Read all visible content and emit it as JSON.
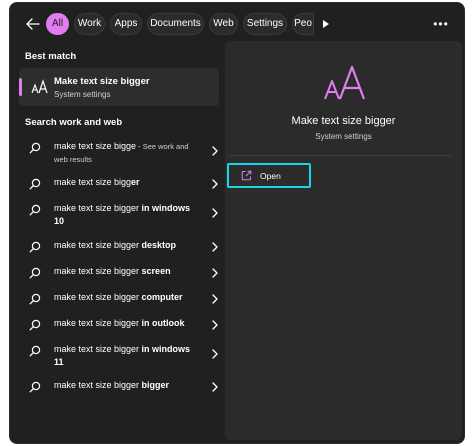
{
  "filters": [
    {
      "label": "All",
      "active": true
    },
    {
      "label": "Work",
      "active": false
    },
    {
      "label": "Apps",
      "active": false
    },
    {
      "label": "Documents",
      "active": false
    },
    {
      "label": "Web",
      "active": false
    },
    {
      "label": "Settings",
      "active": false
    },
    {
      "label": "Peo",
      "active": false
    }
  ],
  "more_label": "•••",
  "best_match": {
    "section_title": "Best match",
    "title": "Make text size bigger",
    "subtitle": "System settings",
    "icon": "text-size-icon"
  },
  "search_section_title": "Search work and web",
  "results": [
    {
      "plain": "make text size bigge",
      "bold": "",
      "hint": " - See work and web results"
    },
    {
      "plain": "make text size bigg",
      "bold": "er",
      "hint": ""
    },
    {
      "plain": "make text size bigger",
      "bold": " in windows 10",
      "hint": ""
    },
    {
      "plain": "make text size bigger",
      "bold": " desktop",
      "hint": ""
    },
    {
      "plain": "make text size bigger",
      "bold": " screen",
      "hint": ""
    },
    {
      "plain": "make text size bigger",
      "bold": " computer",
      "hint": ""
    },
    {
      "plain": "make text size bigger",
      "bold": " in outlook",
      "hint": ""
    },
    {
      "plain": "make text size bigger",
      "bold": " in windows 11",
      "hint": ""
    },
    {
      "plain": "make text size bigger",
      "bold": " bigger",
      "hint": ""
    }
  ],
  "preview": {
    "title": "Make text size bigger",
    "subtitle": "System settings",
    "open_label": "Open"
  },
  "colors": {
    "accent": "#e27cf1",
    "focus": "#1fd3e6",
    "background": "#202020"
  }
}
